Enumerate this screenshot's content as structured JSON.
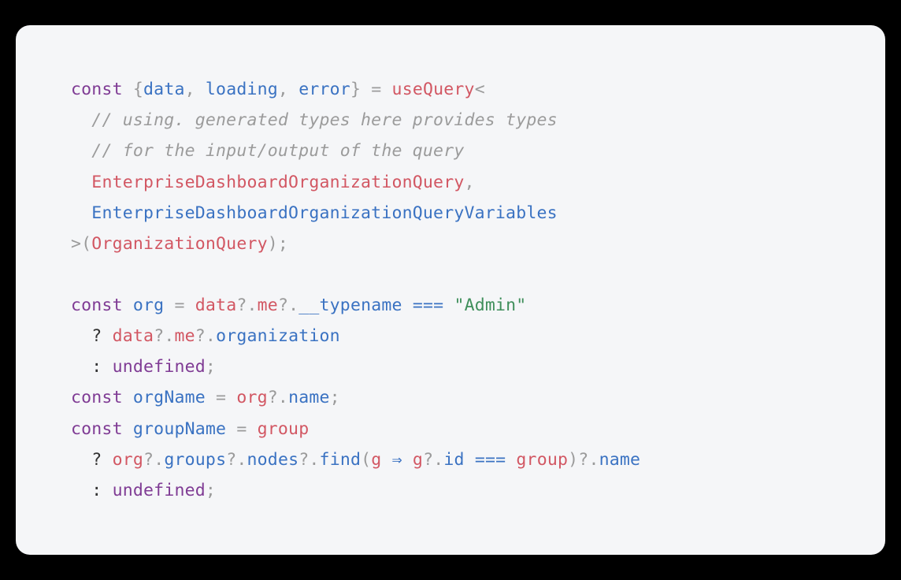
{
  "colors": {
    "background": "#f5f6f8",
    "keyword": "#7f3b94",
    "identifier": "#3a72c2",
    "punctuation_light": "#9b9b9b",
    "punctuation_dark": "#333333",
    "function": "#d25763",
    "comment": "#9b9b9b",
    "string": "#3f8f5b"
  },
  "code": {
    "line1": {
      "const": "const",
      "lbrace": " {",
      "data": "data",
      "c1": ", ",
      "loading": "loading",
      "c2": ", ",
      "error": "error",
      "rbrace": "} ",
      "eq": "= ",
      "useQuery": "useQuery",
      "lt": "<"
    },
    "line2": {
      "indent": "  ",
      "comment": "// using. generated types here provides types"
    },
    "line3": {
      "indent": "  ",
      "comment": "// for the input/output of the query"
    },
    "line4": {
      "indent": "  ",
      "type": "EnterpriseDashboardOrganizationQuery",
      "comma": ","
    },
    "line5": {
      "indent": "  ",
      "type": "EnterpriseDashboardOrganizationQueryVariables"
    },
    "line6": {
      "gt": ">(",
      "arg": "OrganizationQuery",
      "close": ");"
    },
    "line7": {
      "blank": " "
    },
    "line8": {
      "const": "const",
      "sp": " ",
      "org": "org",
      "eq": " = ",
      "data": "data",
      "q1": "?.",
      "me": "me",
      "q2": "?.",
      "typename": "__typename",
      "sp2": " ",
      "eqeq": "===",
      "sp3": " ",
      "str": "\"Admin\""
    },
    "line9": {
      "indent": "  ",
      "q": "?",
      "sp": " ",
      "data": "data",
      "q1": "?.",
      "me": "me",
      "q2": "?.",
      "organization": "organization"
    },
    "line10": {
      "indent": "  ",
      "colon": ":",
      "sp": " ",
      "undef": "undefined",
      "semi": ";"
    },
    "line11": {
      "const": "const",
      "sp": " ",
      "orgName": "orgName",
      "eq": " = ",
      "org": "org",
      "q1": "?.",
      "name": "name",
      "semi": ";"
    },
    "line12": {
      "const": "const",
      "sp": " ",
      "groupName": "groupName",
      "eq": " = ",
      "group": "group"
    },
    "line13": {
      "indent": "  ",
      "q": "?",
      "sp": " ",
      "org": "org",
      "q1": "?.",
      "groups": "groups",
      "q2": "?.",
      "nodes": "nodes",
      "q3": "?.",
      "find": "find",
      "lparen": "(",
      "g": "g",
      "sp2": " ",
      "arrow": "⇒",
      "sp3": " ",
      "g2": "g",
      "q4": "?.",
      "id": "id",
      "sp4": " ",
      "eqeq": "===",
      "sp5": " ",
      "group": "group",
      "rparen": ")",
      "q5": "?.",
      "name": "name"
    },
    "line14": {
      "indent": "  ",
      "colon": ":",
      "sp": " ",
      "undef": "undefined",
      "semi": ";"
    }
  }
}
